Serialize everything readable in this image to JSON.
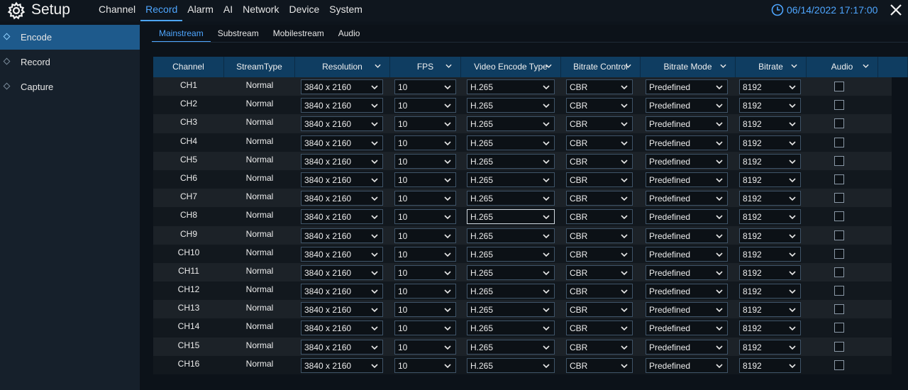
{
  "header": {
    "title": "Setup",
    "nav": [
      "Channel",
      "Record",
      "Alarm",
      "AI",
      "Network",
      "Device",
      "System"
    ],
    "active_nav": "Record",
    "datetime": "06/14/2022 17:17:00",
    "icons": [
      "gear-icon",
      "clock-icon",
      "close-icon"
    ]
  },
  "sidebar": {
    "items": [
      {
        "label": "Encode",
        "active": true
      },
      {
        "label": "Record",
        "active": false
      },
      {
        "label": "Capture",
        "active": false
      }
    ]
  },
  "tabs": {
    "items": [
      "Mainstream",
      "Substream",
      "Mobilestream",
      "Audio"
    ],
    "active": "Mainstream"
  },
  "table": {
    "columns": [
      "Channel",
      "StreamType",
      "Resolution",
      "FPS",
      "Video Encode Type",
      "Bitrate Control",
      "Bitrate Mode",
      "Bitrate",
      "Audio"
    ],
    "rows": [
      {
        "channel": "CH1",
        "stream_type": "Normal",
        "resolution": "3840 x 2160",
        "fps": "10",
        "encode": "H.265",
        "bitrate_control": "CBR",
        "bitrate_mode": "Predefined",
        "bitrate": "8192",
        "audio": false
      },
      {
        "channel": "CH2",
        "stream_type": "Normal",
        "resolution": "3840 x 2160",
        "fps": "10",
        "encode": "H.265",
        "bitrate_control": "CBR",
        "bitrate_mode": "Predefined",
        "bitrate": "8192",
        "audio": false
      },
      {
        "channel": "CH3",
        "stream_type": "Normal",
        "resolution": "3840 x 2160",
        "fps": "10",
        "encode": "H.265",
        "bitrate_control": "CBR",
        "bitrate_mode": "Predefined",
        "bitrate": "8192",
        "audio": false
      },
      {
        "channel": "CH4",
        "stream_type": "Normal",
        "resolution": "3840 x 2160",
        "fps": "10",
        "encode": "H.265",
        "bitrate_control": "CBR",
        "bitrate_mode": "Predefined",
        "bitrate": "8192",
        "audio": false
      },
      {
        "channel": "CH5",
        "stream_type": "Normal",
        "resolution": "3840 x 2160",
        "fps": "10",
        "encode": "H.265",
        "bitrate_control": "CBR",
        "bitrate_mode": "Predefined",
        "bitrate": "8192",
        "audio": false
      },
      {
        "channel": "CH6",
        "stream_type": "Normal",
        "resolution": "3840 x 2160",
        "fps": "10",
        "encode": "H.265",
        "bitrate_control": "CBR",
        "bitrate_mode": "Predefined",
        "bitrate": "8192",
        "audio": false
      },
      {
        "channel": "CH7",
        "stream_type": "Normal",
        "resolution": "3840 x 2160",
        "fps": "10",
        "encode": "H.265",
        "bitrate_control": "CBR",
        "bitrate_mode": "Predefined",
        "bitrate": "8192",
        "audio": false
      },
      {
        "channel": "CH8",
        "stream_type": "Normal",
        "resolution": "3840 x 2160",
        "fps": "10",
        "encode": "H.265",
        "bitrate_control": "CBR",
        "bitrate_mode": "Predefined",
        "bitrate": "8192",
        "audio": false
      },
      {
        "channel": "CH9",
        "stream_type": "Normal",
        "resolution": "3840 x 2160",
        "fps": "10",
        "encode": "H.265",
        "bitrate_control": "CBR",
        "bitrate_mode": "Predefined",
        "bitrate": "8192",
        "audio": false
      },
      {
        "channel": "CH10",
        "stream_type": "Normal",
        "resolution": "3840 x 2160",
        "fps": "10",
        "encode": "H.265",
        "bitrate_control": "CBR",
        "bitrate_mode": "Predefined",
        "bitrate": "8192",
        "audio": false
      },
      {
        "channel": "CH11",
        "stream_type": "Normal",
        "resolution": "3840 x 2160",
        "fps": "10",
        "encode": "H.265",
        "bitrate_control": "CBR",
        "bitrate_mode": "Predefined",
        "bitrate": "8192",
        "audio": false
      },
      {
        "channel": "CH12",
        "stream_type": "Normal",
        "resolution": "3840 x 2160",
        "fps": "10",
        "encode": "H.265",
        "bitrate_control": "CBR",
        "bitrate_mode": "Predefined",
        "bitrate": "8192",
        "audio": false
      },
      {
        "channel": "CH13",
        "stream_type": "Normal",
        "resolution": "3840 x 2160",
        "fps": "10",
        "encode": "H.265",
        "bitrate_control": "CBR",
        "bitrate_mode": "Predefined",
        "bitrate": "8192",
        "audio": false
      },
      {
        "channel": "CH14",
        "stream_type": "Normal",
        "resolution": "3840 x 2160",
        "fps": "10",
        "encode": "H.265",
        "bitrate_control": "CBR",
        "bitrate_mode": "Predefined",
        "bitrate": "8192",
        "audio": false
      },
      {
        "channel": "CH15",
        "stream_type": "Normal",
        "resolution": "3840 x 2160",
        "fps": "10",
        "encode": "H.265",
        "bitrate_control": "CBR",
        "bitrate_mode": "Predefined",
        "bitrate": "8192",
        "audio": false
      },
      {
        "channel": "CH16",
        "stream_type": "Normal",
        "resolution": "3840 x 2160",
        "fps": "10",
        "encode": "H.265",
        "bitrate_control": "CBR",
        "bitrate_mode": "Predefined",
        "bitrate": "8192",
        "audio": false
      }
    ]
  },
  "colors": {
    "accent": "#4ea6ff",
    "sidebar_active": "#1e5a8c",
    "table_header": "#0f3d61",
    "background": "#0d141c"
  }
}
